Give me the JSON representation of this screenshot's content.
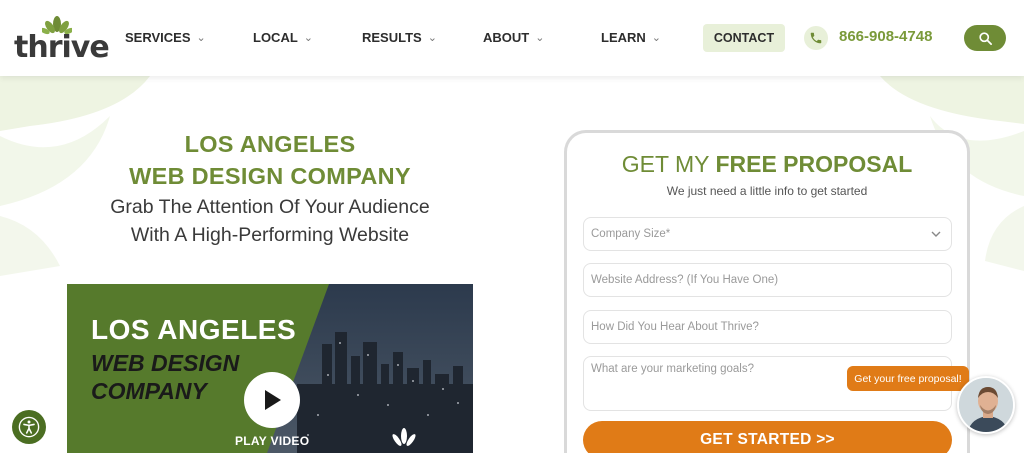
{
  "header": {
    "logo_text": "thrive",
    "nav": [
      {
        "label": "SERVICES"
      },
      {
        "label": "LOCAL"
      },
      {
        "label": "RESULTS"
      },
      {
        "label": "ABOUT"
      },
      {
        "label": "LEARN"
      }
    ],
    "contact_label": "CONTACT",
    "phone": "866-908-4748"
  },
  "hero": {
    "title_line1": "LOS ANGELES",
    "title_line2": "WEB DESIGN COMPANY",
    "sub_line1": "Grab The Attention Of Your Audience",
    "sub_line2": "With A High-Performing Website"
  },
  "video": {
    "line1": "LOS ANGELES",
    "line2": "WEB DESIGN",
    "line3": "COMPANY",
    "play_label": "PLAY VIDEO"
  },
  "form": {
    "title_normal": "GET MY ",
    "title_bold": "FREE PROPOSAL",
    "subtitle": "We just need a little info to get started",
    "company_size_placeholder": "Company Size*",
    "website_placeholder": "Website Address? (If You Have One)",
    "heard_placeholder": "How Did You Hear About Thrive?",
    "goals_placeholder": "What are your marketing goals?",
    "submit_label": "GET STARTED >>"
  },
  "chat": {
    "bubble_text": "Get your free proposal!"
  },
  "colors": {
    "brand_green": "#6f8c36",
    "dark_green": "#4b6e22",
    "accent_orange": "#e07b17",
    "light_green": "#e8f0d9"
  }
}
